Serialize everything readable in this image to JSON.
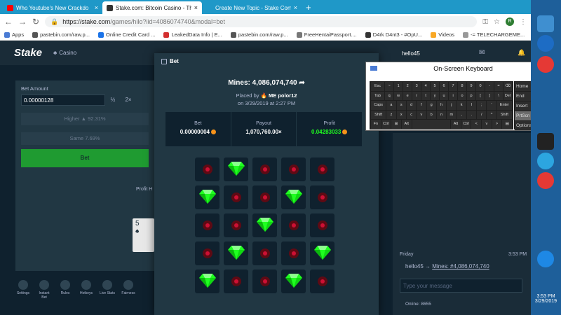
{
  "browser": {
    "tabs": [
      {
        "title": "Who Youtube's New Crackdo",
        "color": "#ff0000"
      },
      {
        "title": "Stake.com: Bitcoin Casino - The I",
        "color": "#333333"
      },
      {
        "title": "Create New Topic - Stake Comm",
        "color": "#1f98c8"
      }
    ],
    "url_host": "https://stake.com",
    "url_path": "/games/hilo?iid=4086074740&modal=bet",
    "bookmarks": [
      "Apps",
      "pastebin.com/raw.p...",
      "Online Credit Card ...",
      "LeakedData Info | E...",
      "pastebin.com/raw.p...",
      "FreeHentaiPassport....",
      "D4rk D4nt3 - #OpU...",
      "Videos",
      "-= TELECHARGEME..."
    ]
  },
  "site": {
    "logo": "Stake",
    "nav_casino": "Casino",
    "username": "hello45"
  },
  "left_panel": {
    "bet_amount_label": "Bet Amount",
    "bet_amount_value": "0.00000128",
    "half": "½",
    "double": "2×",
    "higher": "Higher ▲ 92.31%",
    "same": "Same 7.69%",
    "bet_button": "Bet",
    "profit_label": "Profit H",
    "card_rank": "5",
    "card_suit": "♠"
  },
  "bottom_icons": [
    "Settings",
    "Instant Bet",
    "Rules",
    "Hotkeys",
    "Live Stats",
    "Fairness"
  ],
  "modal": {
    "title": "Bet",
    "mines": "Mines: 4,086,074,740",
    "placed_by_label": "Placed by",
    "placed_by_user": "ME polor12",
    "date": "on 3/29/2019 at 2:27 PM",
    "stats": [
      {
        "label": "Bet",
        "value": "0.00000004",
        "coin": true,
        "color": "#ffffff"
      },
      {
        "label": "Payout",
        "value": "1,070,760.00×",
        "coin": false,
        "color": "#ffffff"
      },
      {
        "label": "Profit",
        "value": "0.04283033",
        "coin": true,
        "color": "#1fff20"
      }
    ],
    "grid": [
      [
        "mine",
        "gem",
        "mine",
        "mine",
        "mine"
      ],
      [
        "gem",
        "mine",
        "mine",
        "gem",
        "mine"
      ],
      [
        "mine",
        "mine",
        "gem",
        "mine",
        "mine"
      ],
      [
        "mine",
        "gem",
        "mine",
        "mine",
        "gem"
      ],
      [
        "gem",
        "mine",
        "mine",
        "gem",
        "mine"
      ]
    ]
  },
  "chat": {
    "day": "Friday",
    "time": "3:53 PM",
    "message_user": "hello45",
    "message_text": "Mines: #4,086,074,740",
    "placeholder": "Type your message",
    "online": "Online: 8655"
  },
  "osk": {
    "title": "On-Screen Keyboard",
    "rows": [
      [
        "Esc",
        "~",
        "1",
        "2",
        "3",
        "4",
        "5",
        "6",
        "7",
        "8",
        "9",
        "0",
        "-",
        "=",
        "⌫"
      ],
      [
        "Tab",
        "q",
        "w",
        "e",
        "r",
        "t",
        "y",
        "u",
        "i",
        "o",
        "p",
        "[",
        "]",
        "\\",
        "Del"
      ],
      [
        "Caps",
        "a",
        "s",
        "d",
        "f",
        "g",
        "h",
        "j",
        "k",
        "l",
        ";",
        "'",
        "Enter"
      ],
      [
        "Shift",
        "z",
        "x",
        "c",
        "v",
        "b",
        "n",
        "m",
        ",",
        ".",
        "/",
        "^",
        "Shift"
      ],
      [
        "Fn",
        "Ctrl",
        "⊞",
        "Alt",
        "",
        "Alt",
        "Ctrl",
        "<",
        "v",
        ">",
        "▤"
      ]
    ],
    "right_keys": [
      "Home",
      "PgUp",
      "End",
      "PgDn",
      "Insert",
      "Pause",
      "PrtScn",
      "ScrLk",
      "Options",
      "Help"
    ]
  },
  "taskbar": {
    "time": "3:53 PM",
    "date": "3/29/2019"
  }
}
